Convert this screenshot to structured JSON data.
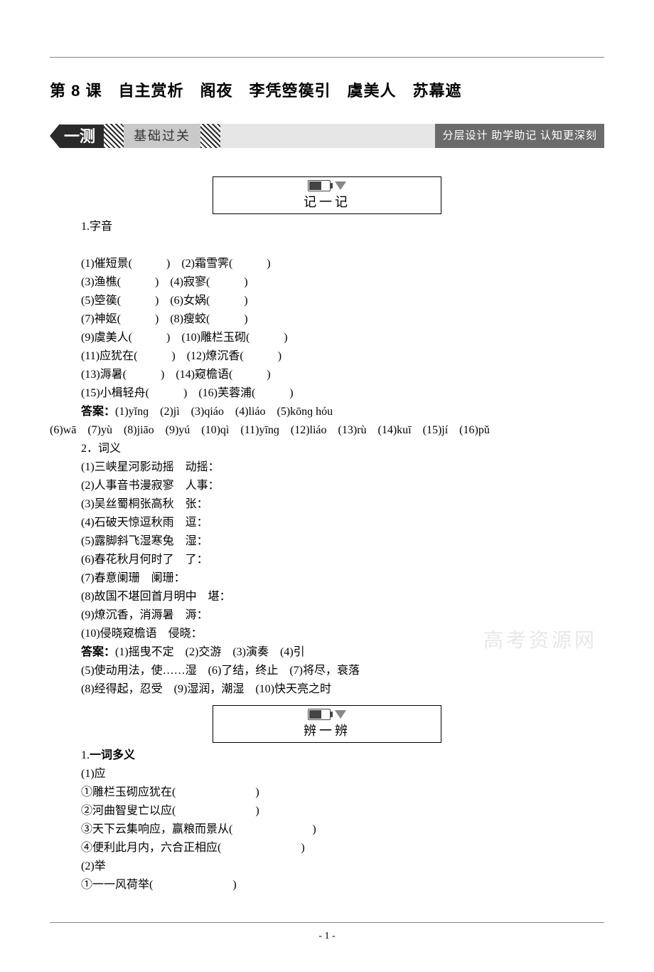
{
  "lesson_title": "第 8 课　自主赏析　阁夜　李凭箜篌引　虞美人　苏幕遮",
  "banner": {
    "left": "一测",
    "mid": "基础过关",
    "right": "分层设计 助学助记 认知更深刻"
  },
  "sub1_label": "记一记",
  "sub2_label": "辨一辨",
  "sec1": {
    "h1": "1.字音",
    "items": [
      "(1)催短景(　　　)　(2)霜雪霁(　　　)",
      "(3)渔樵(　　　)　(4)寂寥(　　　)",
      "(5)箜篌(　　　)　(6)女娲(　　　)",
      "(7)神妪(　　　)　(8)瘦蛟(　　　)",
      "(9)虞美人(　　　)　(10)雕栏玉砌(　　　)",
      "(11)应犹在(　　　)　(12)燎沉香(　　　)",
      "(13)溽暑(　　　)　(14)窥檐语(　　　)",
      "(15)小楫轻舟(　　　)　(16)芙蓉浦(　　　)"
    ],
    "ans_label": "答案：",
    "ans1": "(1)yǐnɡ　(2)jì　(3)qiáo　(4)liáo　(5)kōnɡ hóu",
    "ans2": "(6)wā　(7)yù　(8)jiāo　(9)yú　(10)qì　(11)yīnɡ　(12)liáo　(13)rù　(14)kuī　(15)jí　(16)pǔ",
    "h2": "2．词义",
    "items2": [
      "(1)三峡星河影动摇　动摇：",
      "(2)人事音书漫寂寥　人事：",
      "(3)吴丝蜀桐张高秋　张：",
      "(4)石破天惊逗秋雨　逗：",
      "(5)露脚斜飞湿寒兔　湿：",
      "(6)春花秋月何时了　了：",
      "(7)春意阑珊　阑珊：",
      "(8)故国不堪回首月明中　堪：",
      "(9)燎沉香，消溽暑　溽：",
      "(10)侵晓窥檐语　侵晓："
    ],
    "ans3": "(1)摇曳不定　(2)交游　(3)演奏　(4)引",
    "ans4": "(5)使动用法，使……湿　(6)了结，终止　(7)将尽，衰落",
    "ans5": "(8)经得起，忍受　(9)湿润，潮湿　(10)快天亮之时"
  },
  "sec2": {
    "h1_num": "1.",
    "h1_text": "一词多义",
    "g1": "(1)应",
    "g1_items": [
      "①雕栏玉砌应犹在(　　　　　　　)",
      "②河曲智叟亡以应(　　　　　　　)",
      "③天下云集响应，赢粮而景从(　　　　　　　)",
      "④便利此月内，六合正相应(　　　　　　　)"
    ],
    "g2": "(2)举",
    "g2_items": [
      "①一一风荷举(　　　　　　　)"
    ]
  },
  "watermark": "高考资源网",
  "page_num": "- 1 -"
}
